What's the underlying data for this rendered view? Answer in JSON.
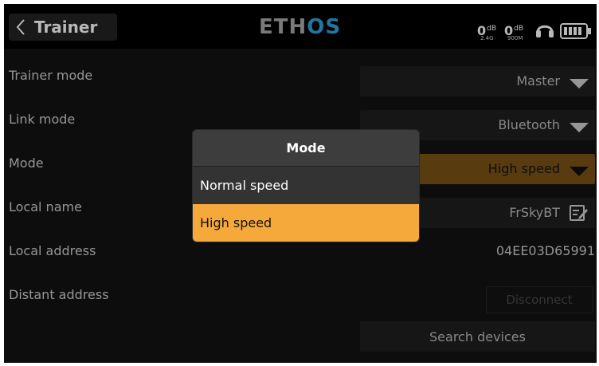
{
  "header": {
    "back_title": "Trainer",
    "logo_main": "ETH",
    "logo_accent": "OS",
    "signal_1_value": "0",
    "signal_1_unit": "dB",
    "signal_1_band": "2.4G",
    "signal_2_value": "0",
    "signal_2_unit": "dB",
    "signal_2_band": "900M"
  },
  "rows": {
    "trainer_mode": {
      "label": "Trainer mode",
      "value": "Master"
    },
    "link_mode": {
      "label": "Link mode",
      "value": "Bluetooth"
    },
    "mode": {
      "label": "Mode",
      "value": "High speed"
    },
    "local_name": {
      "label": "Local name",
      "value": "FrSkyBT"
    },
    "local_address": {
      "label": "Local address",
      "value": "04EE03D65991"
    },
    "distant_address": {
      "label": "Distant address",
      "button": "Disconnect"
    }
  },
  "search_button": "Search devices",
  "dialog": {
    "title": "Mode",
    "options": [
      "Normal speed",
      "High speed"
    ],
    "selected": "High speed"
  },
  "colors": {
    "accent": "#f6a93b",
    "logo_accent": "#2aa7e0",
    "selected_field": "#7a5214"
  },
  "icons": [
    "chevron-left-icon",
    "headset-icon",
    "battery-icon",
    "caret-down-icon",
    "edit-icon"
  ]
}
